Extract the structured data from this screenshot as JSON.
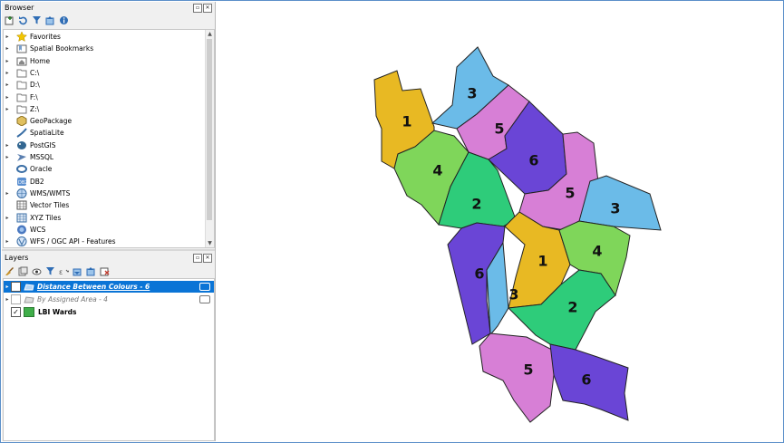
{
  "browser": {
    "title": "Browser",
    "items": [
      {
        "label": "Favorites",
        "icon": "star-icon",
        "expand": true
      },
      {
        "label": "Spatial Bookmarks",
        "icon": "bookmark-icon",
        "expand": true
      },
      {
        "label": "Home",
        "icon": "home-folder-icon",
        "expand": true
      },
      {
        "label": "C:\\",
        "icon": "folder-icon",
        "expand": true
      },
      {
        "label": "D:\\",
        "icon": "folder-icon",
        "expand": true
      },
      {
        "label": "F:\\",
        "icon": "folder-icon",
        "expand": true
      },
      {
        "label": "Z:\\",
        "icon": "folder-icon",
        "expand": true
      },
      {
        "label": "GeoPackage",
        "icon": "geopackage-icon",
        "expand": false
      },
      {
        "label": "SpatiaLite",
        "icon": "spatialite-icon",
        "expand": false
      },
      {
        "label": "PostGIS",
        "icon": "postgis-icon",
        "expand": true
      },
      {
        "label": "MSSQL",
        "icon": "mssql-icon",
        "expand": true
      },
      {
        "label": "Oracle",
        "icon": "oracle-icon",
        "expand": false
      },
      {
        "label": "DB2",
        "icon": "db2-icon",
        "expand": false
      },
      {
        "label": "WMS/WMTS",
        "icon": "wms-icon",
        "expand": true
      },
      {
        "label": "Vector Tiles",
        "icon": "vector-tiles-icon",
        "expand": false
      },
      {
        "label": "XYZ Tiles",
        "icon": "xyz-tiles-icon",
        "expand": true
      },
      {
        "label": "WCS",
        "icon": "wcs-icon",
        "expand": false
      },
      {
        "label": "WFS / OGC API - Features",
        "icon": "wfs-icon",
        "expand": true
      }
    ]
  },
  "layers": {
    "title": "Layers",
    "items": [
      {
        "label": "Distance Between Colours - 6",
        "checked": true,
        "selected": true,
        "style": "italic-underline"
      },
      {
        "label": "By Assigned Area - 4",
        "checked": false,
        "selected": false,
        "style": "italic-grey"
      },
      {
        "label": "LBI Wards",
        "checked": true,
        "selected": false,
        "style": "bold",
        "swatch": "#3fae49"
      }
    ]
  },
  "map": {
    "colors": {
      "1": "#e8b923",
      "2": "#2ecc7a",
      "3": "#6bbbe8",
      "4": "#7fd65a",
      "5": "#d77fd6",
      "6": "#6a45d6"
    },
    "wards": [
      {
        "label": "1"
      },
      {
        "label": "3"
      },
      {
        "label": "5"
      },
      {
        "label": "4"
      },
      {
        "label": "6"
      },
      {
        "label": "5"
      },
      {
        "label": "2"
      },
      {
        "label": "3"
      },
      {
        "label": "6"
      },
      {
        "label": "1"
      },
      {
        "label": "4"
      },
      {
        "label": "3"
      },
      {
        "label": "2"
      },
      {
        "label": "5"
      },
      {
        "label": "6"
      }
    ]
  }
}
